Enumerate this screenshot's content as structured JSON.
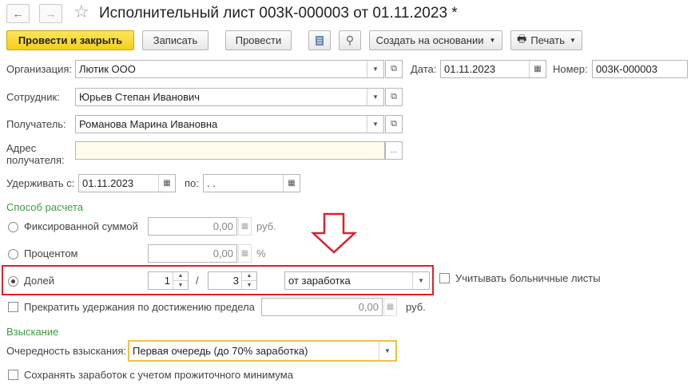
{
  "window": {
    "title": "Исполнительный лист 003К-000003 от 01.11.2023 *"
  },
  "nav": {
    "back_icon": "←",
    "forward_icon": "→",
    "star_icon": "☆"
  },
  "toolbar": {
    "post_close": "Провести и закрыть",
    "save": "Записать",
    "post": "Провести",
    "create_based": "Создать на основании",
    "print": "Печать"
  },
  "form": {
    "org_label": "Организация:",
    "org_value": "Лютик ООО",
    "date_label": "Дата:",
    "date_value": "01.11.2023",
    "number_label": "Номер:",
    "number_value": "003К-000003",
    "employee_label": "Сотрудник:",
    "employee_value": "Юрьев Степан Иванович",
    "recipient_label": "Получатель:",
    "recipient_value": "Романова Марина Ивановна",
    "address_label_1": "Адрес",
    "address_label_2": "получателя:",
    "address_value": "",
    "withhold_from_label": "Удерживать с:",
    "withhold_from_value": "01.11.2023",
    "to_label": "по:",
    "to_value": " .  .",
    "calc_section": "Способ расчета",
    "fixed_label": "Фиксированной суммой",
    "fixed_value": "0,00",
    "fixed_unit": "руб.",
    "percent_label": "Процентом",
    "percent_value": "0,00",
    "percent_unit": "%",
    "share_label": "Долей",
    "share_num": "1",
    "share_slash": "/",
    "share_den": "3",
    "share_base": "от заработка",
    "sick_label": "Учитывать больничные листы",
    "stop_label": "Прекратить удержания по достижению предела",
    "stop_value": "0,00",
    "stop_unit": "руб.",
    "recovery_section": "Взыскание",
    "priority_label": "Очередность взыскания:",
    "priority_value": "Первая очередь (до 70% заработка)",
    "keep_min_label": "Сохранять заработок с учетом прожиточного минимума"
  },
  "colors": {
    "highlight": "#d9232a",
    "primary": "#f4cf1a",
    "section": "#3c9d3c",
    "focus": "#f0c23c"
  }
}
